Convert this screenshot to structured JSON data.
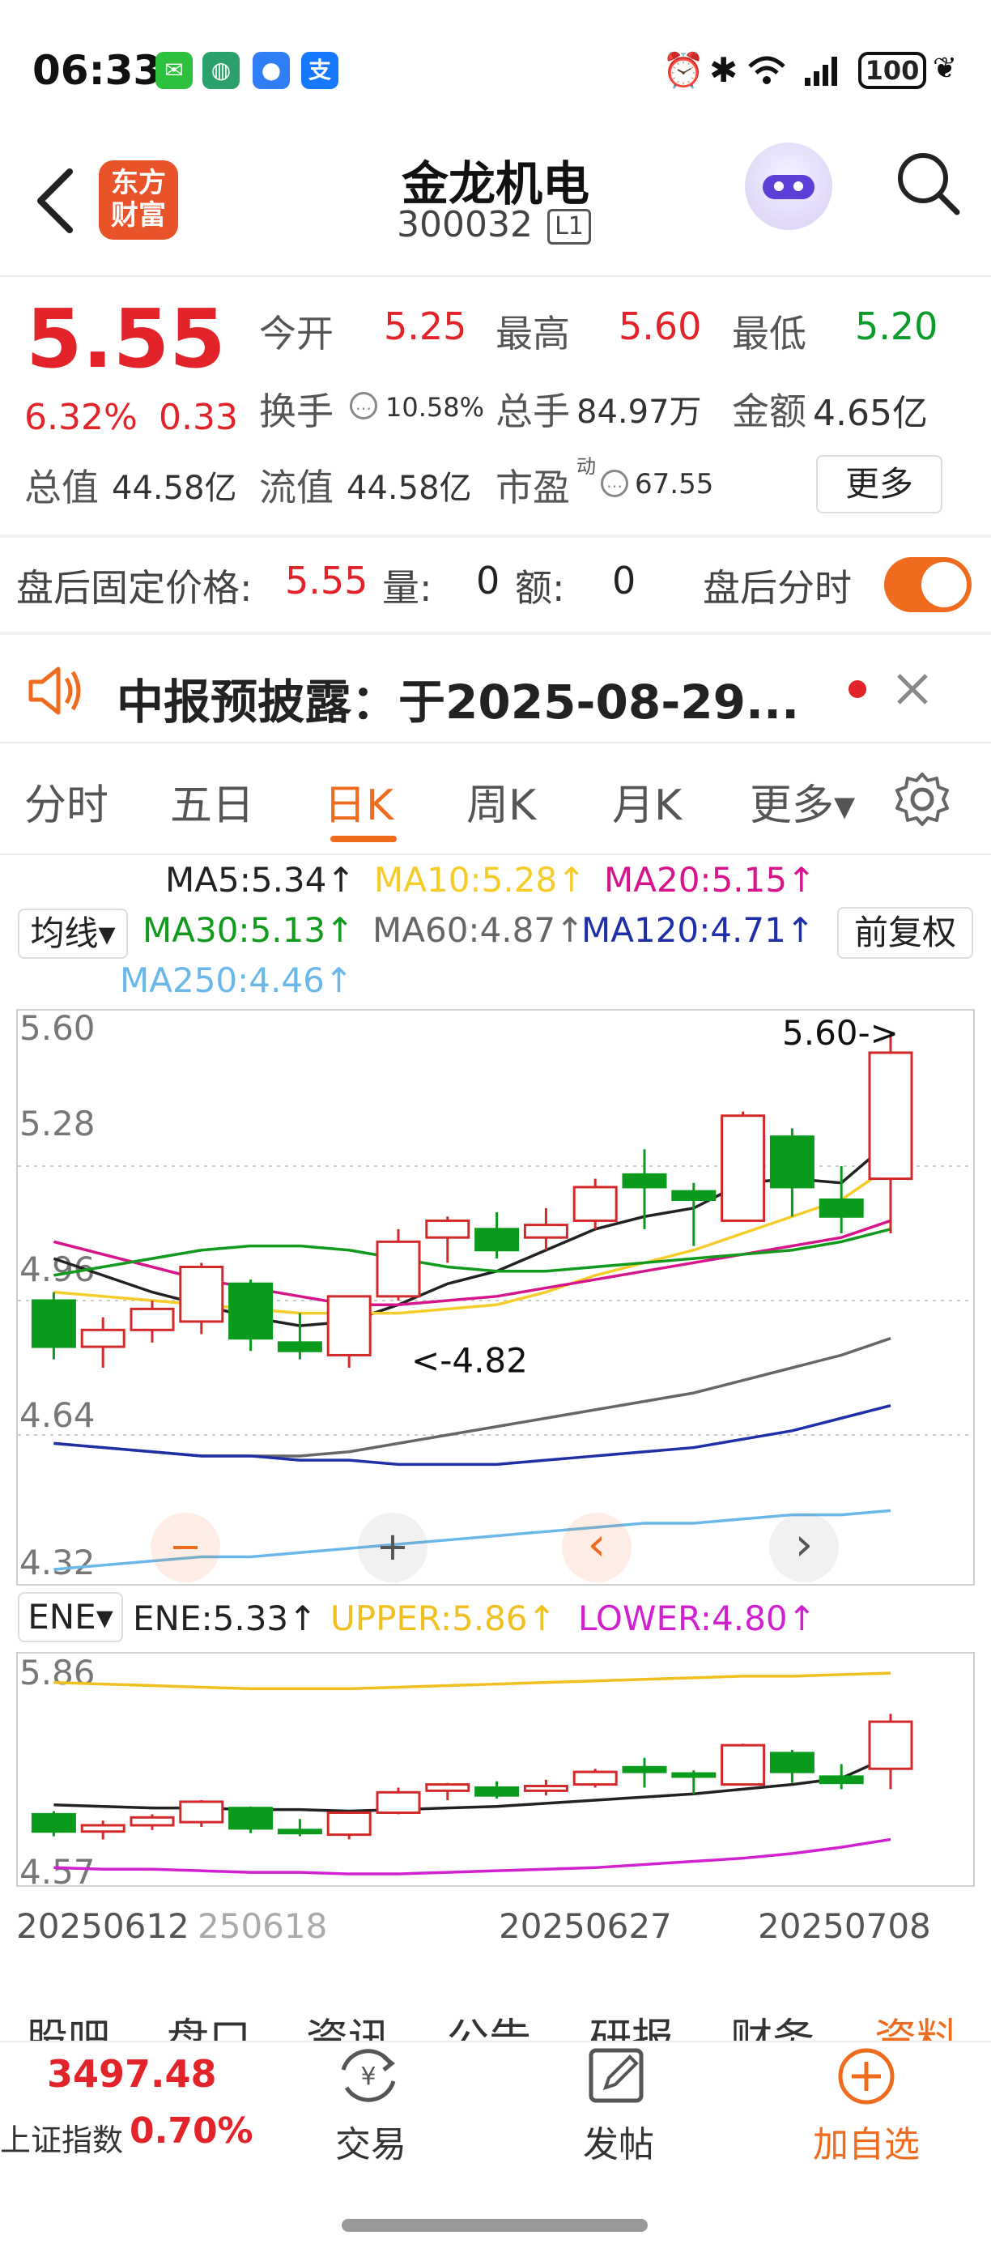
{
  "status_bar": {
    "time": "06:33",
    "apps": [
      {
        "icon": "wechat-icon",
        "color": "#2dc13e",
        "glyph": "✉"
      },
      {
        "icon": "bank-icon",
        "color": "#2aa06a",
        "glyph": "◍"
      },
      {
        "icon": "chat-bubble-icon",
        "color": "#2f7ef5",
        "glyph": "●"
      },
      {
        "icon": "alipay-icon",
        "color": "#1677ff",
        "glyph": "支"
      }
    ],
    "battery": "100"
  },
  "header": {
    "logo_line1": "东方",
    "logo_line2": "财富",
    "title": "金龙机电",
    "code": "300032",
    "level": "L1"
  },
  "quote": {
    "price": "5.55",
    "change_pct": "6.32%",
    "change": "0.33",
    "open_label": "今开",
    "open": "5.25",
    "high_label": "最高",
    "high": "5.60",
    "low_label": "最低",
    "low": "5.20",
    "turnover_label": "换手",
    "turnover": "10.58%",
    "volume_label": "总手",
    "volume": "84.97万",
    "amount_label": "金额",
    "amount": "4.65亿",
    "mktcap_label": "总值",
    "mktcap": "44.58亿",
    "float_label": "流值",
    "float_cap": "44.58亿",
    "pe_label": "市盈",
    "pe_sup": "动",
    "pe": "67.55",
    "more": "更多"
  },
  "after_hours": {
    "price_label": "盘后固定价格:",
    "price": "5.55",
    "vol_label": "量:",
    "vol": "0",
    "amt_label": "额:",
    "amt": "0",
    "timeshare_label": "盘后分时",
    "toggle_on": true
  },
  "notice": {
    "text": "中报预披露：于2025-08-29..."
  },
  "tabs": [
    "分时",
    "五日",
    "日K",
    "周K",
    "月K",
    "更多▾"
  ],
  "active_tab": "日K",
  "ma_panel": {
    "selector": "均线▾",
    "fuquan": "前复权",
    "ma5": "MA5:5.34↑",
    "ma10": "MA10:5.28↑",
    "ma20": "MA20:5.15↑",
    "ma30": "MA30:5.13↑",
    "ma60": "MA60:4.87↑",
    "ma120": "MA120:4.71↑",
    "ma250": "MA250:4.46↑",
    "colors": {
      "ma5": "#222222",
      "ma10": "#f5cc2a",
      "ma20": "#d6158c",
      "ma30": "#129a1c",
      "ma60": "#666666",
      "ma120": "#1e2fa8",
      "ma250": "#6ab8ea"
    }
  },
  "ene_panel": {
    "selector": "ENE▾",
    "ene": "ENE:5.33↑",
    "upper": "UPPER:5.86↑",
    "lower": "LOWER:4.80↑"
  },
  "chart_data": [
    {
      "type": "candlestick",
      "title": "",
      "y_ticks": [
        "5.60",
        "5.28",
        "4.96",
        "4.64",
        "4.32"
      ],
      "ylim": [
        4.32,
        5.6
      ],
      "annotations": {
        "high": "5.60->",
        "low": "<-4.82"
      },
      "grid": "dotted horizontal",
      "candles": [
        {
          "o": 4.96,
          "h": 4.98,
          "l": 4.82,
          "c": 4.85
        },
        {
          "o": 4.85,
          "h": 4.92,
          "l": 4.8,
          "c": 4.89
        },
        {
          "o": 4.89,
          "h": 4.96,
          "l": 4.86,
          "c": 4.94
        },
        {
          "o": 4.91,
          "h": 5.05,
          "l": 4.88,
          "c": 5.04
        },
        {
          "o": 5.0,
          "h": 5.01,
          "l": 4.84,
          "c": 4.87
        },
        {
          "o": 4.86,
          "h": 4.93,
          "l": 4.82,
          "c": 4.84
        },
        {
          "o": 4.83,
          "h": 4.97,
          "l": 4.8,
          "c": 4.97
        },
        {
          "o": 4.97,
          "h": 5.13,
          "l": 4.96,
          "c": 5.1
        },
        {
          "o": 5.11,
          "h": 5.16,
          "l": 5.05,
          "c": 5.15
        },
        {
          "o": 5.13,
          "h": 5.17,
          "l": 5.06,
          "c": 5.08
        },
        {
          "o": 5.11,
          "h": 5.18,
          "l": 5.08,
          "c": 5.14
        },
        {
          "o": 5.15,
          "h": 5.25,
          "l": 5.13,
          "c": 5.23
        },
        {
          "o": 5.26,
          "h": 5.32,
          "l": 5.13,
          "c": 5.23
        },
        {
          "o": 5.22,
          "h": 5.24,
          "l": 5.09,
          "c": 5.2
        },
        {
          "o": 5.15,
          "h": 5.41,
          "l": 5.15,
          "c": 5.4
        },
        {
          "o": 5.35,
          "h": 5.37,
          "l": 5.16,
          "c": 5.23
        },
        {
          "o": 5.2,
          "h": 5.28,
          "l": 5.12,
          "c": 5.16
        },
        {
          "o": 5.25,
          "h": 5.6,
          "l": 5.12,
          "c": 5.55
        }
      ],
      "series": [
        {
          "name": "MA5",
          "values": [
            5.06,
            5.02,
            4.98,
            4.95,
            4.92,
            4.9,
            4.91,
            4.95,
            5.0,
            5.03,
            5.08,
            5.13,
            5.16,
            5.18,
            5.24,
            5.25,
            5.24,
            5.34
          ]
        },
        {
          "name": "MA10",
          "values": [
            4.98,
            4.97,
            4.96,
            4.95,
            4.94,
            4.93,
            4.93,
            4.93,
            4.94,
            4.95,
            4.98,
            5.02,
            5.05,
            5.08,
            5.12,
            5.16,
            5.2,
            5.28
          ]
        },
        {
          "name": "MA20",
          "values": [
            5.1,
            5.07,
            5.04,
            5.01,
            4.99,
            4.97,
            4.95,
            4.95,
            4.96,
            4.97,
            4.99,
            5.01,
            5.03,
            5.05,
            5.07,
            5.09,
            5.11,
            5.15
          ]
        },
        {
          "name": "MA30",
          "values": [
            5.02,
            5.04,
            5.06,
            5.08,
            5.09,
            5.09,
            5.08,
            5.06,
            5.04,
            5.03,
            5.03,
            5.04,
            5.05,
            5.06,
            5.07,
            5.08,
            5.1,
            5.13
          ]
        },
        {
          "name": "MA60",
          "values": [
            4.62,
            4.61,
            4.6,
            4.59,
            4.59,
            4.59,
            4.6,
            4.62,
            4.64,
            4.66,
            4.68,
            4.7,
            4.72,
            4.74,
            4.77,
            4.8,
            4.83,
            4.87
          ]
        },
        {
          "name": "MA120",
          "values": [
            4.62,
            4.61,
            4.6,
            4.59,
            4.59,
            4.58,
            4.58,
            4.57,
            4.57,
            4.57,
            4.58,
            4.59,
            4.6,
            4.61,
            4.63,
            4.65,
            4.68,
            4.71
          ]
        },
        {
          "name": "MA250",
          "values": [
            4.32,
            4.33,
            4.34,
            4.35,
            4.35,
            4.36,
            4.37,
            4.38,
            4.39,
            4.4,
            4.41,
            4.42,
            4.43,
            4.43,
            4.44,
            4.45,
            4.45,
            4.46
          ]
        }
      ]
    },
    {
      "type": "candlestick",
      "title": "",
      "y_ticks": [
        "5.86",
        "4.57"
      ],
      "ylim": [
        4.57,
        5.86
      ],
      "series": [
        {
          "name": "UPPER",
          "values": [
            5.8,
            5.79,
            5.78,
            5.77,
            5.76,
            5.76,
            5.76,
            5.77,
            5.78,
            5.79,
            5.8,
            5.81,
            5.82,
            5.83,
            5.84,
            5.84,
            5.85,
            5.86
          ]
        },
        {
          "name": "ENE",
          "values": [
            5.02,
            5.01,
            5.0,
            5.0,
            4.99,
            4.99,
            4.98,
            4.99,
            5.0,
            5.01,
            5.03,
            5.05,
            5.07,
            5.09,
            5.12,
            5.15,
            5.19,
            5.33
          ]
        },
        {
          "name": "LOWER",
          "values": [
            4.62,
            4.61,
            4.61,
            4.6,
            4.59,
            4.59,
            4.58,
            4.58,
            4.59,
            4.6,
            4.61,
            4.62,
            4.64,
            4.66,
            4.68,
            4.71,
            4.75,
            4.8
          ]
        }
      ]
    }
  ],
  "x_dates": [
    "20250612",
    "250618",
    "20250627",
    "20250708"
  ],
  "bottom_tabs_partial": [
    "股吧",
    "盘口",
    "资讯",
    "公告",
    "研报",
    "财务",
    "资料"
  ],
  "bottom_nav": {
    "index_value": "3497.48",
    "index_name": "上证指数",
    "index_change": "0.70%",
    "trade": "交易",
    "post": "发帖",
    "add": "加自选"
  },
  "zoom_controls": [
    "−",
    "+",
    "‹",
    "›"
  ]
}
